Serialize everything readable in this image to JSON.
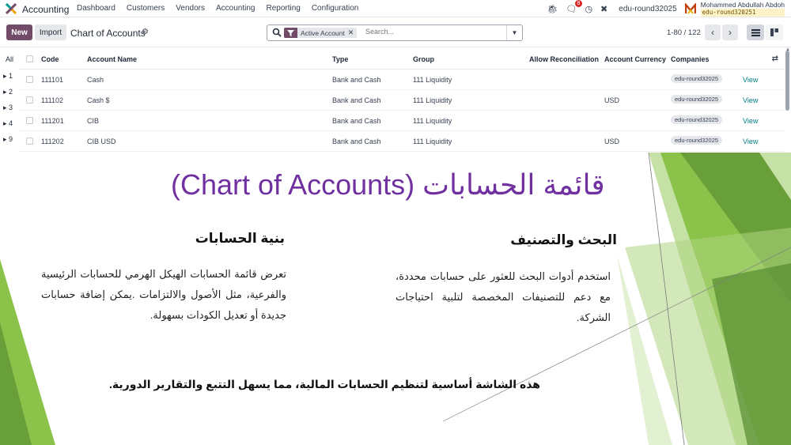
{
  "navbar": {
    "app_name": "Accounting",
    "menu": [
      "Dashboard",
      "Customers",
      "Vendors",
      "Accounting",
      "Reporting",
      "Configuration"
    ],
    "messages_count": "8",
    "company": "edu-round32025",
    "user_name": "Mohammed Abdullah Abdoh",
    "user_db": "edu-round320251"
  },
  "control": {
    "new_label": "New",
    "import_label": "Import",
    "breadcrumb": "Chart of Accounts",
    "facet_label": "Active Account",
    "search_placeholder": "Search...",
    "pager": "1-80 / 122"
  },
  "groups": {
    "all_label": "All",
    "items": [
      "1",
      "2",
      "3",
      "4",
      "9"
    ]
  },
  "table": {
    "headers": {
      "code": "Code",
      "name": "Account Name",
      "type": "Type",
      "group": "Group",
      "reconcile": "Allow Reconciliation",
      "currency": "Account Currency",
      "companies": "Companies"
    },
    "rows": [
      {
        "code": "111101",
        "name": "Cash",
        "type": "Bank and Cash",
        "group": "111 Liquidity",
        "currency": "",
        "company": "edu-round32025",
        "action": "View"
      },
      {
        "code": "111102",
        "name": "Cash $",
        "type": "Bank and Cash",
        "group": "111 Liquidity",
        "currency": "USD",
        "company": "edu-round32025",
        "action": "View"
      },
      {
        "code": "111201",
        "name": "CIB",
        "type": "Bank and Cash",
        "group": "111 Liquidity",
        "currency": "",
        "company": "edu-round32025",
        "action": "View"
      },
      {
        "code": "111202",
        "name": "CIB USD",
        "type": "Bank and Cash",
        "group": "111 Liquidity",
        "currency": "USD",
        "company": "edu-round32025",
        "action": "View"
      }
    ]
  },
  "slide": {
    "title": "قائمة الحسابات (Chart of Accounts)",
    "right_heading": "البحث والتصنيف",
    "right_text": "استخدم أدوات البحث للعثور على حسابات محددة، مع دعم للتصنيفات المخصصة لتلبية احتياجات الشركة.",
    "left_heading": "بنية الحسابات",
    "left_text": "تعرض قائمة الحسابات الهيكل الهرمي للحسابات الرئيسية والفرعية، مثل الأصول والالتزامات .يمكن إضافة حسابات جديدة أو تعديل الكودات بسهولة.",
    "footer": "هذه الشاشة أساسية لتنظيم الحسابات المالية، مما يسهل التتبع والتقارير الدورية."
  },
  "colors": {
    "brand": "#714b67",
    "link": "#017e84",
    "title_purple": "#7030a0",
    "green": "#7cb342"
  }
}
